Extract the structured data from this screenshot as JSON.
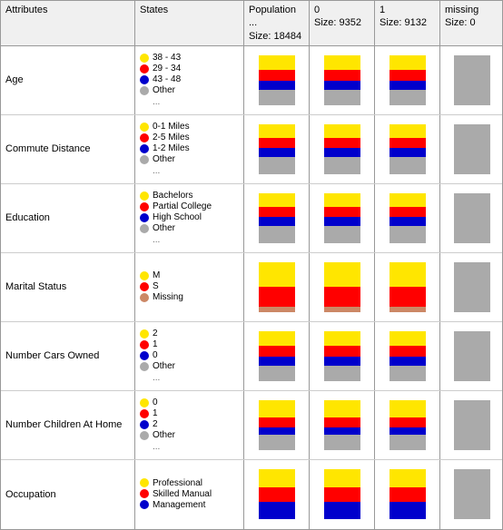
{
  "header": {
    "attributes_label": "Attributes",
    "states_label": "States",
    "pop_label": "Population ...",
    "pop_size": "Size: 18484",
    "col0_label": "0",
    "col0_size": "Size: 9352",
    "col1_label": "1",
    "col1_size": "Size: 9132",
    "missing_label": "missing",
    "missing_size": "Size: 0"
  },
  "rows": [
    {
      "attribute": "Age",
      "states": [
        {
          "color": "#FFE600",
          "label": "38 - 43"
        },
        {
          "color": "#FF0000",
          "label": "29 - 34"
        },
        {
          "color": "#0000CC",
          "label": "43 - 48"
        },
        {
          "color": "#AAAAAA",
          "label": "Other"
        }
      ],
      "show_ellipsis": true,
      "charts": [
        {
          "segments": [
            {
              "color": "#FFE600",
              "pct": 30
            },
            {
              "color": "#FF0000",
              "pct": 22
            },
            {
              "color": "#0000CC",
              "pct": 18
            },
            {
              "color": "#AAAAAA",
              "pct": 30
            }
          ],
          "gray": false
        },
        {
          "segments": [
            {
              "color": "#FFE600",
              "pct": 30
            },
            {
              "color": "#FF0000",
              "pct": 22
            },
            {
              "color": "#0000CC",
              "pct": 18
            },
            {
              "color": "#AAAAAA",
              "pct": 30
            }
          ],
          "gray": false
        },
        {
          "segments": [
            {
              "color": "#FFE600",
              "pct": 30
            },
            {
              "color": "#FF0000",
              "pct": 22
            },
            {
              "color": "#0000CC",
              "pct": 18
            },
            {
              "color": "#AAAAAA",
              "pct": 30
            }
          ],
          "gray": false
        },
        {
          "segments": [],
          "gray": true
        }
      ]
    },
    {
      "attribute": "Commute Distance",
      "states": [
        {
          "color": "#FFE600",
          "label": "0-1 Miles"
        },
        {
          "color": "#FF0000",
          "label": "2-5 Miles"
        },
        {
          "color": "#0000CC",
          "label": "1-2 Miles"
        },
        {
          "color": "#AAAAAA",
          "label": "Other"
        }
      ],
      "show_ellipsis": true,
      "charts": [
        {
          "segments": [
            {
              "color": "#FFE600",
              "pct": 28
            },
            {
              "color": "#FF0000",
              "pct": 20
            },
            {
              "color": "#0000CC",
              "pct": 18
            },
            {
              "color": "#AAAAAA",
              "pct": 34
            }
          ],
          "gray": false
        },
        {
          "segments": [
            {
              "color": "#FFE600",
              "pct": 28
            },
            {
              "color": "#FF0000",
              "pct": 20
            },
            {
              "color": "#0000CC",
              "pct": 18
            },
            {
              "color": "#AAAAAA",
              "pct": 34
            }
          ],
          "gray": false
        },
        {
          "segments": [
            {
              "color": "#FFE600",
              "pct": 28
            },
            {
              "color": "#FF0000",
              "pct": 20
            },
            {
              "color": "#0000CC",
              "pct": 18
            },
            {
              "color": "#AAAAAA",
              "pct": 34
            }
          ],
          "gray": false
        },
        {
          "segments": [],
          "gray": true
        }
      ]
    },
    {
      "attribute": "Education",
      "states": [
        {
          "color": "#FFE600",
          "label": "Bachelors"
        },
        {
          "color": "#FF0000",
          "label": "Partial College"
        },
        {
          "color": "#0000CC",
          "label": "High School"
        },
        {
          "color": "#AAAAAA",
          "label": "Other"
        }
      ],
      "show_ellipsis": true,
      "charts": [
        {
          "segments": [
            {
              "color": "#FFE600",
              "pct": 28
            },
            {
              "color": "#FF0000",
              "pct": 20
            },
            {
              "color": "#0000CC",
              "pct": 18
            },
            {
              "color": "#AAAAAA",
              "pct": 34
            }
          ],
          "gray": false
        },
        {
          "segments": [
            {
              "color": "#FFE600",
              "pct": 28
            },
            {
              "color": "#FF0000",
              "pct": 20
            },
            {
              "color": "#0000CC",
              "pct": 18
            },
            {
              "color": "#AAAAAA",
              "pct": 34
            }
          ],
          "gray": false
        },
        {
          "segments": [
            {
              "color": "#FFE600",
              "pct": 28
            },
            {
              "color": "#FF0000",
              "pct": 20
            },
            {
              "color": "#0000CC",
              "pct": 18
            },
            {
              "color": "#AAAAAA",
              "pct": 34
            }
          ],
          "gray": false
        },
        {
          "segments": [],
          "gray": true
        }
      ]
    },
    {
      "attribute": "Marital Status",
      "states": [
        {
          "color": "#FFE600",
          "label": "M"
        },
        {
          "color": "#FF0000",
          "label": "S"
        },
        {
          "color": "#CC8866",
          "label": "Missing"
        }
      ],
      "show_ellipsis": false,
      "charts": [
        {
          "segments": [
            {
              "color": "#FFE600",
              "pct": 50
            },
            {
              "color": "#FF0000",
              "pct": 40
            },
            {
              "color": "#CC8866",
              "pct": 10
            }
          ],
          "gray": false
        },
        {
          "segments": [
            {
              "color": "#FFE600",
              "pct": 50
            },
            {
              "color": "#FF0000",
              "pct": 40
            },
            {
              "color": "#CC8866",
              "pct": 10
            }
          ],
          "gray": false
        },
        {
          "segments": [
            {
              "color": "#FFE600",
              "pct": 50
            },
            {
              "color": "#FF0000",
              "pct": 40
            },
            {
              "color": "#CC8866",
              "pct": 10
            }
          ],
          "gray": false
        },
        {
          "segments": [],
          "gray": true
        }
      ]
    },
    {
      "attribute": "Number Cars Owned",
      "states": [
        {
          "color": "#FFE600",
          "label": "2"
        },
        {
          "color": "#FF0000",
          "label": "1"
        },
        {
          "color": "#0000CC",
          "label": "0"
        },
        {
          "color": "#AAAAAA",
          "label": "Other"
        }
      ],
      "show_ellipsis": true,
      "charts": [
        {
          "segments": [
            {
              "color": "#FFE600",
              "pct": 30
            },
            {
              "color": "#FF0000",
              "pct": 22
            },
            {
              "color": "#0000CC",
              "pct": 18
            },
            {
              "color": "#AAAAAA",
              "pct": 30
            }
          ],
          "gray": false
        },
        {
          "segments": [
            {
              "color": "#FFE600",
              "pct": 30
            },
            {
              "color": "#FF0000",
              "pct": 22
            },
            {
              "color": "#0000CC",
              "pct": 18
            },
            {
              "color": "#AAAAAA",
              "pct": 30
            }
          ],
          "gray": false
        },
        {
          "segments": [
            {
              "color": "#FFE600",
              "pct": 30
            },
            {
              "color": "#FF0000",
              "pct": 22
            },
            {
              "color": "#0000CC",
              "pct": 18
            },
            {
              "color": "#AAAAAA",
              "pct": 30
            }
          ],
          "gray": false
        },
        {
          "segments": [],
          "gray": true
        }
      ]
    },
    {
      "attribute": "Number Children At Home",
      "states": [
        {
          "color": "#FFE600",
          "label": "0"
        },
        {
          "color": "#FF0000",
          "label": "1"
        },
        {
          "color": "#0000CC",
          "label": "2"
        },
        {
          "color": "#AAAAAA",
          "label": "Other"
        }
      ],
      "show_ellipsis": true,
      "charts": [
        {
          "segments": [
            {
              "color": "#FFE600",
              "pct": 35
            },
            {
              "color": "#FF0000",
              "pct": 20
            },
            {
              "color": "#0000CC",
              "pct": 15
            },
            {
              "color": "#AAAAAA",
              "pct": 30
            }
          ],
          "gray": false
        },
        {
          "segments": [
            {
              "color": "#FFE600",
              "pct": 35
            },
            {
              "color": "#FF0000",
              "pct": 20
            },
            {
              "color": "#0000CC",
              "pct": 15
            },
            {
              "color": "#AAAAAA",
              "pct": 30
            }
          ],
          "gray": false
        },
        {
          "segments": [
            {
              "color": "#FFE600",
              "pct": 35
            },
            {
              "color": "#FF0000",
              "pct": 20
            },
            {
              "color": "#0000CC",
              "pct": 15
            },
            {
              "color": "#AAAAAA",
              "pct": 30
            }
          ],
          "gray": false
        },
        {
          "segments": [],
          "gray": true
        }
      ]
    },
    {
      "attribute": "Occupation",
      "states": [
        {
          "color": "#FFE600",
          "label": "Professional"
        },
        {
          "color": "#FF0000",
          "label": "Skilled Manual"
        },
        {
          "color": "#0000CC",
          "label": "Management"
        }
      ],
      "show_ellipsis": false,
      "charts": [
        {
          "segments": [
            {
              "color": "#FFE600",
              "pct": 35
            },
            {
              "color": "#FF0000",
              "pct": 30
            },
            {
              "color": "#0000CC",
              "pct": 35
            }
          ],
          "gray": false
        },
        {
          "segments": [
            {
              "color": "#FFE600",
              "pct": 35
            },
            {
              "color": "#FF0000",
              "pct": 30
            },
            {
              "color": "#0000CC",
              "pct": 35
            }
          ],
          "gray": false
        },
        {
          "segments": [
            {
              "color": "#FFE600",
              "pct": 35
            },
            {
              "color": "#FF0000",
              "pct": 30
            },
            {
              "color": "#0000CC",
              "pct": 35
            }
          ],
          "gray": false
        },
        {
          "segments": [],
          "gray": true
        }
      ]
    }
  ]
}
